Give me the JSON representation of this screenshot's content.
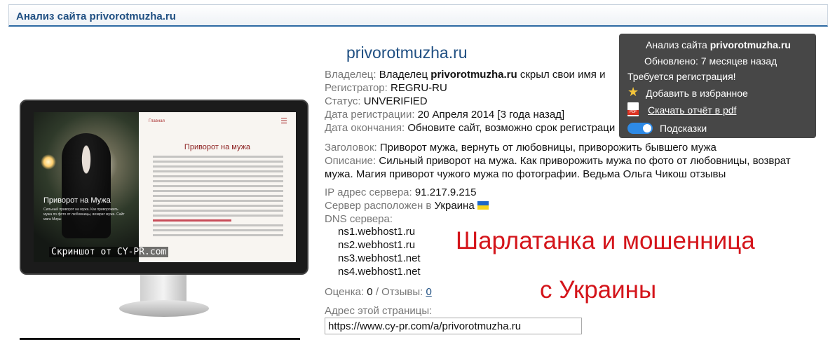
{
  "header": {
    "title": "Анализ сайта privorotmuzha.ru"
  },
  "screenshot": {
    "photo_caption": "Приворот на Мужа",
    "photo_sub": "Сильный приворот на мужа. Как приворожить мужа по фото от любовницы, возврат мужа. Сайт мага Миры",
    "site_top": "Главная",
    "heading": "Приворот на мужа",
    "watermark": "Скриншот от CY-PR.com"
  },
  "site": {
    "domain": "privorotmuzha.ru",
    "owner_label": "Владелец:",
    "owner_pre": "Владелец",
    "owner_domain": "privorotmuzha.ru",
    "owner_post": "скрыл свои имя и",
    "registrar_label": "Регистратор:",
    "registrar": "REGRU-RU",
    "status_label": "Статус:",
    "status": "UNVERIFIED",
    "reg_date_label": "Дата регистрации:",
    "reg_date": "20 Апреля 2014 [3 года назад]",
    "exp_date_label": "Дата окончания:",
    "exp_date": "Обновите сайт, возможно срок регистраци",
    "title_label": "Заголовок:",
    "title_value": "Приворот мужа, вернуть от любовницы, приворожить бывшего мужа",
    "desc_label": "Описание:",
    "desc_line1": "Сильный приворот на мужа. Как приворожить мужа по фото от любовницы, возврат",
    "desc_line2": "мужа. Магия приворот чужого мужа по фотографии. Ведьма Ольга Чикош отзывы",
    "ip_label": "IP адрес сервера:",
    "ip": "91.217.9.215",
    "server_label": "Сервер расположен в",
    "server_country": "Украина",
    "dns_label": "DNS сервера:",
    "dns": [
      "ns1.webhost1.ru",
      "ns2.webhost1.ru",
      "ns3.webhost1.net",
      "ns4.webhost1.net"
    ],
    "rating_label": "Оценка:",
    "rating": "0",
    "reviews_label": "/ Отзывы:",
    "reviews": "0",
    "page_address_label": "Адрес этой страницы:",
    "page_address": "https://www.cy-pr.com/a/privorotmuzha.ru"
  },
  "overlay": {
    "line1": "Шарлатанка и мошенница",
    "line2": "с Украины",
    "color": "#d4151b"
  },
  "tooltip": {
    "title_prefix": "Анализ сайта",
    "title_domain": "privorotmuzha.ru",
    "updated": "Обновлено: 7 месяцев назад",
    "registration": "Требуется регистрация!",
    "favorite": "Добавить в избранное",
    "pdf": "Скачать отчёт в pdf",
    "hints": "Подсказки"
  }
}
